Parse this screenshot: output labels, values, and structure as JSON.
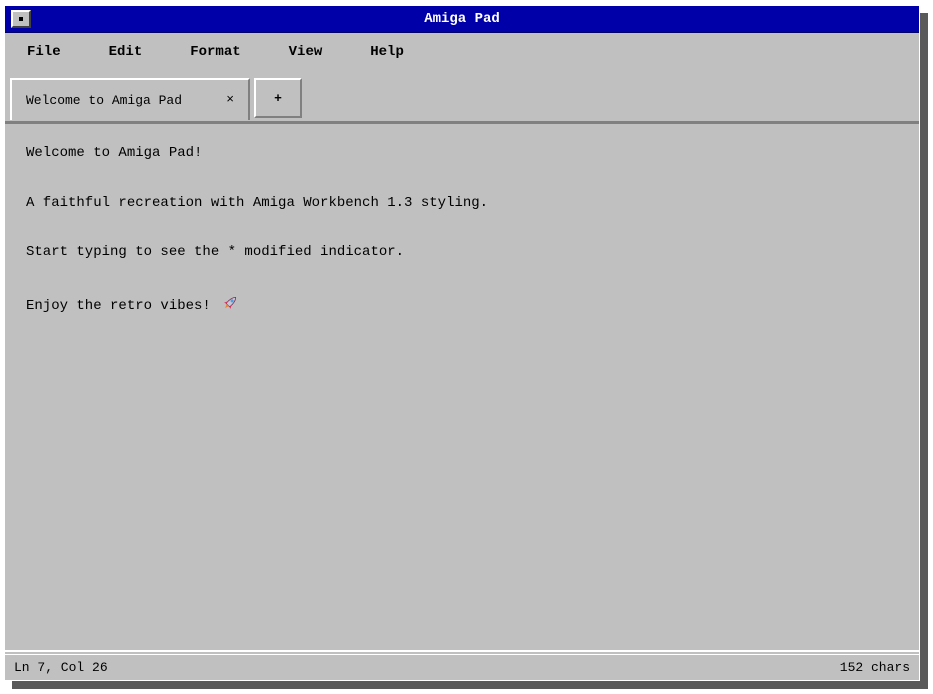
{
  "window": {
    "title": "Amiga Pad"
  },
  "menu": {
    "items": [
      {
        "label": "File"
      },
      {
        "label": "Edit"
      },
      {
        "label": "Format"
      },
      {
        "label": "View"
      },
      {
        "label": "Help"
      }
    ]
  },
  "tabs": {
    "active": {
      "label": "Welcome to Amiga Pad",
      "close_glyph": "×"
    },
    "new_tab_glyph": "+"
  },
  "editor": {
    "lines": [
      "Welcome to Amiga Pad!",
      "A faithful recreation with Amiga Workbench 1.3 styling.",
      "Start typing to see the * modified indicator.",
      "Enjoy the retro vibes! "
    ],
    "trailing_icon": "rocket-icon"
  },
  "status": {
    "position": "Ln 7, Col 26",
    "char_count": "152 chars"
  },
  "colors": {
    "titlebar": "#0000a8",
    "window_bg": "#c0c0c0",
    "shadow": "#5a5a5a"
  }
}
